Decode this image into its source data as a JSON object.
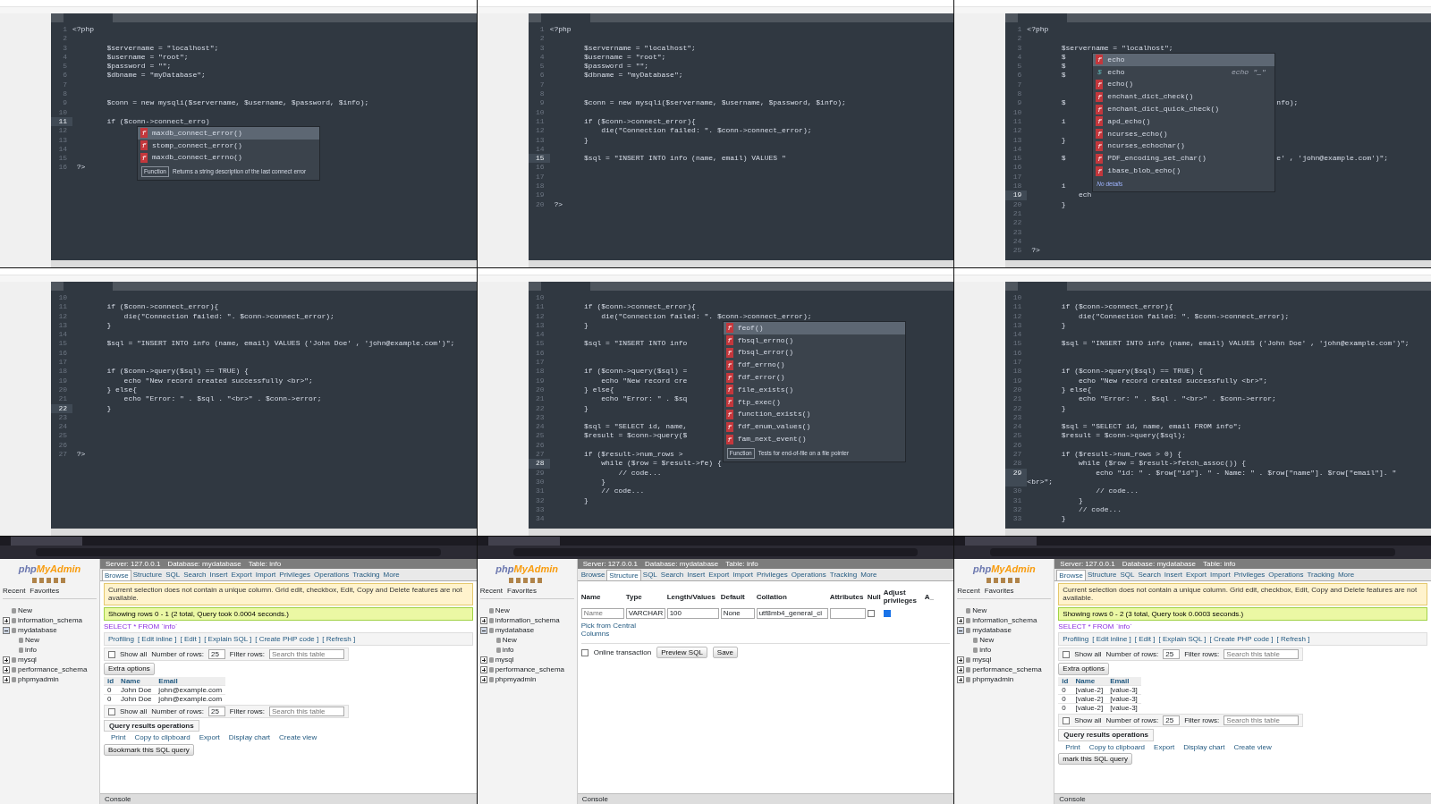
{
  "tiles": [
    {
      "kind": "editor",
      "lines": [
        {
          "num": "1",
          "code": "<?php",
          "current": false
        },
        {
          "num": "2",
          "current": false
        },
        {
          "num": "3",
          "code": "        $servername = \"localhost\";",
          "current": false
        },
        {
          "num": "4",
          "code": "        $username = \"root\";",
          "current": false
        },
        {
          "num": "5",
          "code": "        $password = \"\";",
          "current": false
        },
        {
          "num": "6",
          "code": "        $dbname = \"myDatabase\";",
          "current": false
        },
        {
          "num": "7",
          "current": false
        },
        {
          "num": "8",
          "current": false
        },
        {
          "num": "9",
          "code": "        $conn = new mysqli($servername, $username, $password, $info);",
          "current": false
        },
        {
          "num": "10",
          "current": false
        },
        {
          "num": "11",
          "code": "        if ($conn->connect_erro)",
          "current": true,
          "popup": {
            "items": [
              {
                "kind": "function",
                "icon": "f",
                "label": "maxdb_connect_error()",
                "selected": true
              },
              {
                "kind": "function",
                "icon": "f",
                "label": "stomp_connect_error()",
                "selected": false
              },
              {
                "kind": "function",
                "icon": "f",
                "label": "maxdb_connect_errno()",
                "selected": false
              }
            ],
            "description": {
              "label": "Function",
              "text": "Returns a string description of the last connect error"
            }
          }
        },
        {
          "num": "12",
          "current": false
        },
        {
          "num": "13",
          "current": false
        },
        {
          "num": "14",
          "current": false
        },
        {
          "num": "15",
          "current": false
        },
        {
          "num": "16",
          "code": " ?>",
          "current": false
        }
      ]
    },
    {
      "kind": "editor",
      "lines": [
        {
          "num": "1",
          "code": "<?php",
          "current": false
        },
        {
          "num": "2",
          "current": false
        },
        {
          "num": "3",
          "code": "        $servername = \"localhost\";",
          "current": false
        },
        {
          "num": "4",
          "code": "        $username = \"root\";",
          "current": false
        },
        {
          "num": "5",
          "code": "        $password = \"\";",
          "current": false
        },
        {
          "num": "6",
          "code": "        $dbname = \"myDatabase\";",
          "current": false
        },
        {
          "num": "7",
          "current": false
        },
        {
          "num": "8",
          "current": false
        },
        {
          "num": "9",
          "code": "        $conn = new mysqli($servername, $username, $password, $info);",
          "current": false
        },
        {
          "num": "10",
          "current": false
        },
        {
          "num": "11",
          "code": "        if ($conn->connect_error){",
          "current": false
        },
        {
          "num": "12",
          "code": "            die(\"Connection failed: \". $conn->connect_error);",
          "current": false
        },
        {
          "num": "13",
          "code": "        }",
          "current": false
        },
        {
          "num": "14",
          "current": false
        },
        {
          "num": "15",
          "code": "        $sql = \"INSERT INTO info (name, email) VALUES \"",
          "current": true
        },
        {
          "num": "16",
          "current": false
        },
        {
          "num": "17",
          "current": false
        },
        {
          "num": "18",
          "current": false
        },
        {
          "num": "19",
          "current": false
        },
        {
          "num": "20",
          "code": " ?>",
          "current": false
        }
      ]
    },
    {
      "kind": "editor",
      "lines": [
        {
          "num": "1",
          "code": "<?php",
          "current": false
        },
        {
          "num": "2",
          "current": false
        },
        {
          "num": "3",
          "code": "        $servername = \"localhost\";",
          "current": false,
          "popup": {
            "items": [
              {
                "kind": "function",
                "icon": "f",
                "label": "echo",
                "selected": true
              },
              {
                "kind": "snippet",
                "icon": "$",
                "label": "echo",
                "hint": "echo \"_\"",
                "selected": false
              },
              {
                "kind": "function",
                "icon": "f",
                "label": "echo()",
                "selected": false
              },
              {
                "kind": "function",
                "icon": "f",
                "label": "enchant_dict_check()",
                "selected": false
              },
              {
                "kind": "function",
                "icon": "f",
                "label": "enchant_dict_quick_check()",
                "selected": false
              },
              {
                "kind": "function",
                "icon": "f",
                "label": "apd_echo()",
                "selected": false
              },
              {
                "kind": "function",
                "icon": "f",
                "label": "ncurses_echo()",
                "selected": false
              },
              {
                "kind": "function",
                "icon": "f",
                "label": "ncurses_echochar()",
                "selected": false
              },
              {
                "kind": "function",
                "icon": "f",
                "label": "PDF_encoding_set_char()",
                "selected": false
              },
              {
                "kind": "function",
                "icon": "f",
                "label": "ibase_blob_echo()",
                "selected": false
              }
            ],
            "description": {
              "text": "No details"
            }
          }
        },
        {
          "num": "4",
          "code": "        $",
          "current": false
        },
        {
          "num": "5",
          "code": "        $",
          "current": false
        },
        {
          "num": "6",
          "code": "        $",
          "current": false
        },
        {
          "num": "7",
          "current": false
        },
        {
          "num": "8",
          "current": false
        },
        {
          "num": "9",
          "code": "        $",
          "tail": "nfo);",
          "current": false
        },
        {
          "num": "10",
          "current": false
        },
        {
          "num": "11",
          "code": "        i",
          "current": false
        },
        {
          "num": "12",
          "current": false
        },
        {
          "num": "13",
          "code": "        }",
          "current": false
        },
        {
          "num": "14",
          "current": false
        },
        {
          "num": "15",
          "code": "        $",
          "tail": "e' , 'john@example.com')\";",
          "current": false
        },
        {
          "num": "16",
          "current": false
        },
        {
          "num": "17",
          "current": false
        },
        {
          "num": "18",
          "code": "        i",
          "current": false
        },
        {
          "num": "19",
          "code": "            ech",
          "current": true
        },
        {
          "num": "20",
          "code": "        }",
          "current": false
        },
        {
          "num": "21",
          "current": false
        },
        {
          "num": "22",
          "current": false
        },
        {
          "num": "23",
          "current": false
        },
        {
          "num": "24",
          "current": false
        },
        {
          "num": "25",
          "code": " ?>",
          "current": false
        }
      ]
    },
    {
      "kind": "editor",
      "lines": [
        {
          "num": "10",
          "current": false
        },
        {
          "num": "11",
          "code": "        if ($conn->connect_error){",
          "current": false
        },
        {
          "num": "12",
          "code": "            die(\"Connection failed: \". $conn->connect_error);",
          "current": false
        },
        {
          "num": "13",
          "code": "        }",
          "current": false
        },
        {
          "num": "14",
          "current": false
        },
        {
          "num": "15",
          "code": "        $sql = \"INSERT INTO info (name, email) VALUES ('John Doe' , 'john@example.com')\";",
          "current": false
        },
        {
          "num": "16",
          "current": false
        },
        {
          "num": "17",
          "current": false
        },
        {
          "num": "18",
          "code": "        if ($conn->query($sql) == TRUE) {",
          "current": false
        },
        {
          "num": "19",
          "code": "            echo \"New record created successfully <br>\";",
          "current": false
        },
        {
          "num": "20",
          "code": "        } else{",
          "current": false
        },
        {
          "num": "21",
          "code": "            echo \"Error: \" . $sql . \"<br>\" . $conn->error;",
          "current": false
        },
        {
          "num": "22",
          "code": "        }",
          "current": true
        },
        {
          "num": "23",
          "current": false
        },
        {
          "num": "24",
          "current": false
        },
        {
          "num": "25",
          "current": false
        },
        {
          "num": "26",
          "current": false
        },
        {
          "num": "27",
          "code": " ?>",
          "current": false
        }
      ]
    },
    {
      "kind": "editor",
      "lines": [
        {
          "num": "10",
          "current": false
        },
        {
          "num": "11",
          "code": "        if ($conn->connect_error){",
          "current": false
        },
        {
          "num": "12",
          "code": "            die(\"Connection failed: \". $conn->connect_error);",
          "current": false,
          "popup": {
            "items": [
              {
                "kind": "function",
                "icon": "f",
                "label": "feof()",
                "selected": true
              },
              {
                "kind": "function",
                "icon": "f",
                "label": "fbsql_errno()",
                "selected": false
              },
              {
                "kind": "function",
                "icon": "f",
                "label": "fbsql_error()",
                "selected": false
              },
              {
                "kind": "function",
                "icon": "f",
                "label": "fdf_errno()",
                "selected": false
              },
              {
                "kind": "function",
                "icon": "f",
                "label": "fdf_error()",
                "selected": false
              },
              {
                "kind": "function",
                "icon": "f",
                "label": "file_exists()",
                "selected": false
              },
              {
                "kind": "function",
                "icon": "f",
                "label": "ftp_exec()",
                "selected": false
              },
              {
                "kind": "function",
                "icon": "f",
                "label": "function_exists()",
                "selected": false
              },
              {
                "kind": "function",
                "icon": "f",
                "label": "fdf_enum_values()",
                "selected": false
              },
              {
                "kind": "function",
                "icon": "f",
                "label": "fam_next_event()",
                "selected": false
              }
            ],
            "description": {
              "label": "Function",
              "text": "Tests for end-of-file on a file pointer"
            }
          }
        },
        {
          "num": "13",
          "code": "        }",
          "current": false
        },
        {
          "num": "14",
          "current": false
        },
        {
          "num": "15",
          "code": "        $sql = \"INSERT INTO info",
          "current": false
        },
        {
          "num": "16",
          "current": false
        },
        {
          "num": "17",
          "current": false
        },
        {
          "num": "18",
          "code": "        if ($conn->query($sql) =",
          "current": false
        },
        {
          "num": "19",
          "code": "            echo \"New record cre",
          "current": false
        },
        {
          "num": "20",
          "code": "        } else{",
          "current": false
        },
        {
          "num": "21",
          "code": "            echo \"Error: \" . $sq",
          "current": false
        },
        {
          "num": "22",
          "code": "        }",
          "current": false
        },
        {
          "num": "23",
          "current": false
        },
        {
          "num": "24",
          "code": "        $sql = \"SELECT id, name,",
          "current": false
        },
        {
          "num": "25",
          "code": "        $result = $conn->query($",
          "current": false
        },
        {
          "num": "26",
          "current": false
        },
        {
          "num": "27",
          "code": "        if ($result->num_rows >",
          "current": false
        },
        {
          "num": "28",
          "code": "            while ($row = $result->fe) {",
          "current": true
        },
        {
          "num": "29",
          "code": "                // code...",
          "current": false
        },
        {
          "num": "30",
          "code": "            }",
          "current": false
        },
        {
          "num": "31",
          "code": "            // code...",
          "current": false
        },
        {
          "num": "32",
          "code": "        }",
          "current": false
        },
        {
          "num": "33",
          "current": false
        },
        {
          "num": "34",
          "current": false
        }
      ]
    },
    {
      "kind": "editor",
      "lines": [
        {
          "num": "10",
          "current": false
        },
        {
          "num": "11",
          "code": "        if ($conn->connect_error){",
          "current": false
        },
        {
          "num": "12",
          "code": "            die(\"Connection failed: \". $conn->connect_error);",
          "current": false
        },
        {
          "num": "13",
          "code": "        }",
          "current": false
        },
        {
          "num": "14",
          "current": false
        },
        {
          "num": "15",
          "code": "        $sql = \"INSERT INTO info (name, email) VALUES ('John Doe' , 'john@example.com')\";",
          "current": false
        },
        {
          "num": "16",
          "current": false
        },
        {
          "num": "17",
          "current": false
        },
        {
          "num": "18",
          "code": "        if ($conn->query($sql) == TRUE) {",
          "current": false
        },
        {
          "num": "19",
          "code": "            echo \"New record created successfully <br>\";",
          "current": false
        },
        {
          "num": "20",
          "code": "        } else{",
          "current": false
        },
        {
          "num": "21",
          "code": "            echo \"Error: \" . $sql . \"<br>\" . $conn->error;",
          "current": false
        },
        {
          "num": "22",
          "code": "        }",
          "current": false
        },
        {
          "num": "23",
          "current": false
        },
        {
          "num": "24",
          "code": "        $sql = \"SELECT id, name, email FROM info\";",
          "current": false
        },
        {
          "num": "25",
          "code": "        $result = $conn->query($sql);",
          "current": false
        },
        {
          "num": "26",
          "current": false
        },
        {
          "num": "27",
          "code": "        if ($result->num_rows > 0) {",
          "current": false
        },
        {
          "num": "28",
          "code": "            while ($row = $result->fetch_assoc()) {",
          "current": false
        },
        {
          "num": "29",
          "code": "                echo \"id: \" . $row[\"id\"]. \" - Name: \" . $row[\"name\"]. $row[\"email\"]. \"<br>\";",
          "current": true
        },
        {
          "num": "30",
          "code": "                // code...",
          "current": false
        },
        {
          "num": "31",
          "code": "            }",
          "current": false
        },
        {
          "num": "32",
          "code": "            // code...",
          "current": false
        },
        {
          "num": "33",
          "code": "        }",
          "current": false
        }
      ]
    },
    {
      "kind": "browser",
      "breadcrumb": [
        "Server: 127.0.0.1",
        "Database: mydatabase",
        "Table: info"
      ],
      "nav": {
        "logo": [
          "php",
          "MyAdmin"
        ],
        "links": [
          "Recent",
          "Favorites"
        ],
        "tree": [
          {
            "label": "New"
          },
          {
            "label": "information_schema",
            "expanded": false
          },
          {
            "label": "mydatabase",
            "expanded": true,
            "children": [
              {
                "label": "New"
              },
              {
                "label": "info"
              }
            ]
          },
          {
            "label": "mysql",
            "expanded": false
          },
          {
            "label": "performance_schema",
            "expanded": false
          },
          {
            "label": "phpmyadmin",
            "expanded": false
          }
        ]
      },
      "tabs": [
        {
          "label": "Browse",
          "selected": true
        },
        {
          "label": "Structure",
          "selected": false
        },
        {
          "label": "SQL",
          "selected": false
        },
        {
          "label": "Search",
          "selected": false
        },
        {
          "label": "Insert",
          "selected": false
        },
        {
          "label": "Export",
          "selected": false
        },
        {
          "label": "Import",
          "selected": false
        },
        {
          "label": "Privileges",
          "selected": false
        },
        {
          "label": "Operations",
          "selected": false
        },
        {
          "label": "Tracking",
          "selected": false
        },
        {
          "label": "More",
          "selected": false
        }
      ],
      "blocks": [
        {
          "kind": "notice",
          "text": "Current selection does not contain a unique column. Grid edit, checkbox, Edit, Copy and Delete features are not available."
        },
        {
          "kind": "success",
          "text": "Showing rows 0 - 1 (2 total, Query took 0.0004 seconds.)"
        },
        {
          "kind": "sql",
          "text": "SELECT * FROM `info`"
        },
        {
          "kind": "links",
          "items": [
            "Profiling",
            "[ Edit inline ]",
            "[ Edit ]",
            "[ Explain SQL ]",
            "[ Create PHP code ]",
            "[ Refresh ]"
          ]
        },
        {
          "kind": "filter",
          "show_all_checked": false,
          "show_all": "Show all",
          "rows_label": "Number of rows:",
          "rows_value": "25",
          "filter_label": "Filter rows:",
          "placeholder": "Search this table"
        },
        {
          "kind": "button",
          "text": "Extra options"
        },
        {
          "kind": "table",
          "columns": [
            "id",
            "Name",
            "Email"
          ],
          "rows": [
            [
              "0",
              "John Doe",
              "john@example.com"
            ],
            [
              "0",
              "John Doe",
              "john@example.com"
            ]
          ]
        },
        {
          "kind": "filter",
          "show_all_checked": false,
          "show_all": "Show all",
          "rows_label": "Number of rows:",
          "rows_value": "25",
          "filter_label": "Filter rows:",
          "placeholder": "Search this table"
        },
        {
          "kind": "heading",
          "text": "Query results operations"
        },
        {
          "kind": "actions",
          "items": [
            "Print",
            "Copy to clipboard",
            "Export",
            "Display chart",
            "Create view"
          ]
        },
        {
          "kind": "button",
          "text": "Bookmark this SQL query"
        }
      ],
      "console": "Console"
    },
    {
      "kind": "browser",
      "breadcrumb": [
        "Server: 127.0.0.1",
        "Database: mydatabase",
        "Table: info"
      ],
      "nav": {
        "logo": [
          "php",
          "MyAdmin"
        ],
        "links": [
          "Recent",
          "Favorites"
        ],
        "tree": [
          {
            "label": "New"
          },
          {
            "label": "information_schema",
            "expanded": false
          },
          {
            "label": "mydatabase",
            "expanded": true,
            "children": [
              {
                "label": "New"
              },
              {
                "label": "info"
              }
            ]
          },
          {
            "label": "mysql",
            "expanded": false
          },
          {
            "label": "performance_schema",
            "expanded": false
          },
          {
            "label": "phpmyadmin",
            "expanded": false
          }
        ]
      },
      "tabs": [
        {
          "label": "Browse",
          "selected": false
        },
        {
          "label": "Structure",
          "selected": true
        },
        {
          "label": "SQL",
          "selected": false
        },
        {
          "label": "Search",
          "selected": false
        },
        {
          "label": "Insert",
          "selected": false
        },
        {
          "label": "Export",
          "selected": false
        },
        {
          "label": "Import",
          "selected": false
        },
        {
          "label": "Privileges",
          "selected": false
        },
        {
          "label": "Operations",
          "selected": false
        },
        {
          "label": "Tracking",
          "selected": false
        },
        {
          "label": "More",
          "selected": false
        }
      ],
      "blocks": [
        {
          "kind": "column_form",
          "headers": [
            "Name",
            "Type",
            "Length/Values",
            "Default",
            "Collation",
            "Attributes",
            "Null",
            "Adjust privileges",
            "A_"
          ],
          "name_placeholder": "Name",
          "type": "VARCHAR",
          "length": "100",
          "default": "None",
          "collation": "utf8mb4_general_ci",
          "null_checked": false,
          "privileges_checked": true,
          "pick_link": "Pick from Central Columns"
        },
        {
          "kind": "save_row",
          "online": "Online transaction",
          "online_checked": false,
          "preview": "Preview SQL",
          "save": "Save"
        }
      ],
      "console": "Console"
    },
    {
      "kind": "browser",
      "breadcrumb": [
        "Server: 127.0.0.1",
        "Database: mydatabase",
        "Table: info"
      ],
      "nav": {
        "logo": [
          "php",
          "MyAdmin"
        ],
        "links": [
          "Recent",
          "Favorites"
        ],
        "tree": [
          {
            "label": "New"
          },
          {
            "label": "information_schema",
            "expanded": false
          },
          {
            "label": "mydatabase",
            "expanded": true,
            "children": [
              {
                "label": "New"
              },
              {
                "label": "info"
              }
            ]
          },
          {
            "label": "mysql",
            "expanded": false
          },
          {
            "label": "performance_schema",
            "expanded": false
          },
          {
            "label": "phpmyadmin",
            "expanded": false
          }
        ]
      },
      "tabs": [
        {
          "label": "Browse",
          "selected": true
        },
        {
          "label": "Structure",
          "selected": false
        },
        {
          "label": "SQL",
          "selected": false
        },
        {
          "label": "Search",
          "selected": false
        },
        {
          "label": "Insert",
          "selected": false
        },
        {
          "label": "Export",
          "selected": false
        },
        {
          "label": "Import",
          "selected": false
        },
        {
          "label": "Privileges",
          "selected": false
        },
        {
          "label": "Operations",
          "selected": false
        },
        {
          "label": "Tracking",
          "selected": false
        },
        {
          "label": "More",
          "selected": false
        }
      ],
      "blocks": [
        {
          "kind": "notice",
          "text": "Current selection does not contain a unique column. Grid edit, checkbox, Edit, Copy and Delete features are not available."
        },
        {
          "kind": "success",
          "text": "Showing rows 0 - 2 (3 total, Query took 0.0003 seconds.)"
        },
        {
          "kind": "sql",
          "text": "SELECT * FROM `info`"
        },
        {
          "kind": "links",
          "items": [
            "Profiling",
            "[ Edit inline ]",
            "[ Edit ]",
            "[ Explain SQL ]",
            "[ Create PHP code ]",
            "[ Refresh ]"
          ]
        },
        {
          "kind": "filter",
          "show_all_checked": false,
          "show_all": "Show all",
          "rows_label": "Number of rows:",
          "rows_value": "25",
          "filter_label": "Filter rows:",
          "placeholder": "Search this table"
        },
        {
          "kind": "button",
          "text": "Extra options"
        },
        {
          "kind": "table",
          "columns": [
            "id",
            "Name",
            "Email"
          ],
          "rows": [
            [
              "0",
              "[value-2]",
              "[value-3]"
            ],
            [
              "0",
              "[value-2]",
              "[value-3]"
            ],
            [
              "0",
              "[value-2]",
              "[value-3]"
            ]
          ]
        },
        {
          "kind": "filter",
          "show_all_checked": false,
          "show_all": "Show all",
          "rows_label": "Number of rows:",
          "rows_value": "25",
          "filter_label": "Filter rows:",
          "placeholder": "Search this table"
        },
        {
          "kind": "heading",
          "text": "Query results operations"
        },
        {
          "kind": "actions",
          "items": [
            "Print",
            "Copy to clipboard",
            "Export",
            "Display chart",
            "Create view"
          ]
        },
        {
          "kind": "button",
          "text": "mark this SQL query"
        }
      ],
      "console": "Console"
    }
  ]
}
